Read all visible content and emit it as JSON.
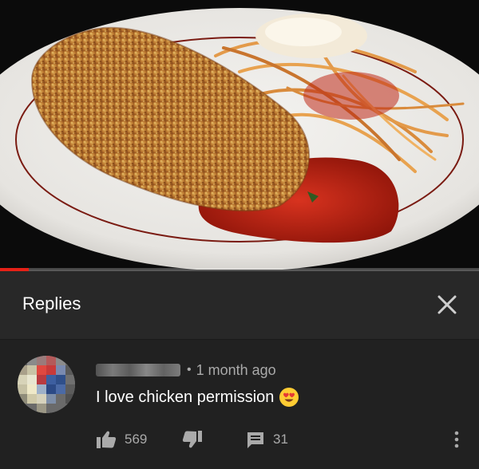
{
  "replies_panel": {
    "title": "Replies"
  },
  "video": {
    "progress_fraction": 0.06
  },
  "comment": {
    "time_ago": "1 month ago",
    "text": "I love chicken permission",
    "emoji": "heart-eyes-emoji",
    "likes": "569",
    "replies": "31"
  },
  "colors": {
    "panel_header_bg": "#282828",
    "comment_bg": "#212121",
    "secondary_text": "#aaaaaa",
    "progress_red": "#e62117"
  },
  "icons": {
    "close": "close-icon",
    "like": "thumbs-up-icon",
    "dislike": "thumbs-down-icon",
    "reply": "comment-icon",
    "more": "more-vert-icon"
  }
}
